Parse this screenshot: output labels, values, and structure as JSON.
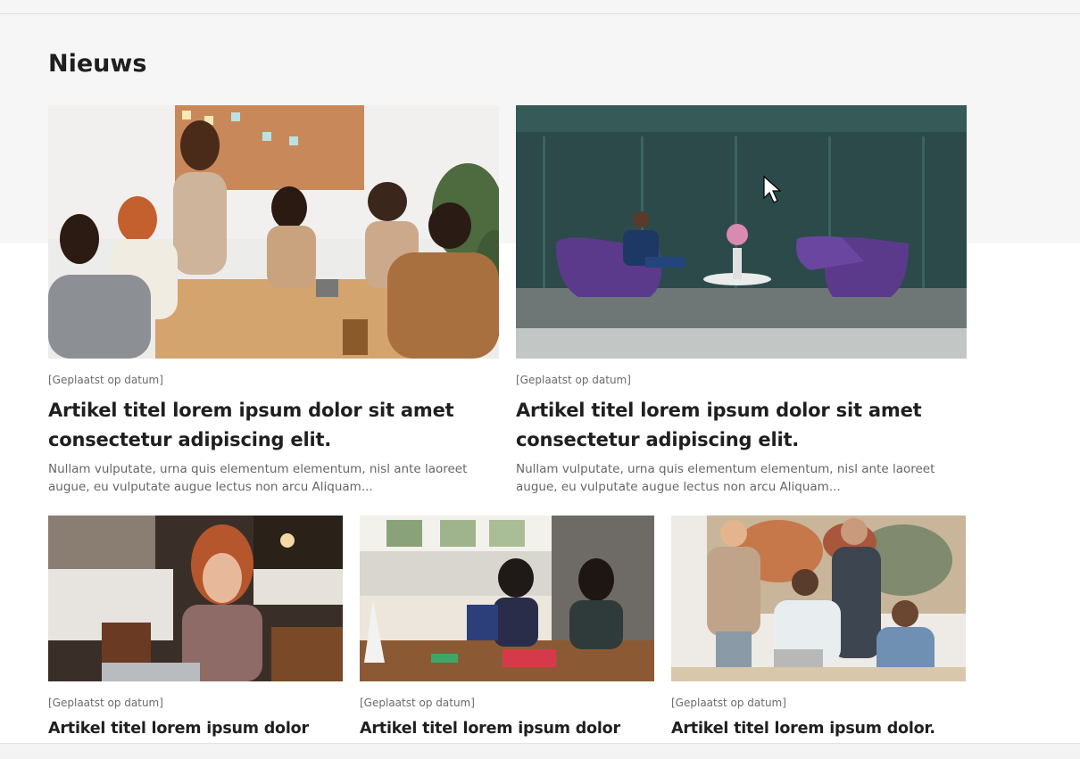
{
  "section": {
    "title": "Nieuws"
  },
  "featured": [
    {
      "image_alt": "Team meeting with handshake around office table",
      "date": "[Geplaatst op datum]",
      "title": "Artikel titel lorem ipsum dolor sit amet consectetur adipiscing elit.",
      "excerpt": "Nullam vulputate, urna quis elementum elementum, nisl ante laoreet augue, eu vulputate augue lectus non arcu Aliquam..."
    },
    {
      "image_alt": "Man sitting in purple lounge chair in glass lobby",
      "date": "[Geplaatst op datum]",
      "title": "Artikel titel lorem ipsum dolor sit amet consectetur adipiscing elit.",
      "excerpt": "Nullam vulputate, urna quis elementum elementum, nisl ante laoreet augue, eu vulputate augue lectus non arcu Aliquam..."
    }
  ],
  "articles": [
    {
      "image_alt": "Woman smiling at laptop in cafe",
      "date": "[Geplaatst op datum]",
      "title": "Artikel titel lorem ipsum dolor"
    },
    {
      "image_alt": "Two women talking at kitchen table with laptop",
      "date": "[Geplaatst op datum]",
      "title": "Artikel titel lorem ipsum dolor"
    },
    {
      "image_alt": "Group of colleagues gathered around a laptop",
      "date": "[Geplaatst op datum]",
      "title": "Artikel titel lorem ipsum dolor."
    }
  ],
  "colors": {
    "background_top": "#f6f6f6",
    "text_primary": "#1f1f1f",
    "text_secondary": "#666666"
  },
  "icons": {
    "cursor": "mouse-pointer-icon"
  }
}
